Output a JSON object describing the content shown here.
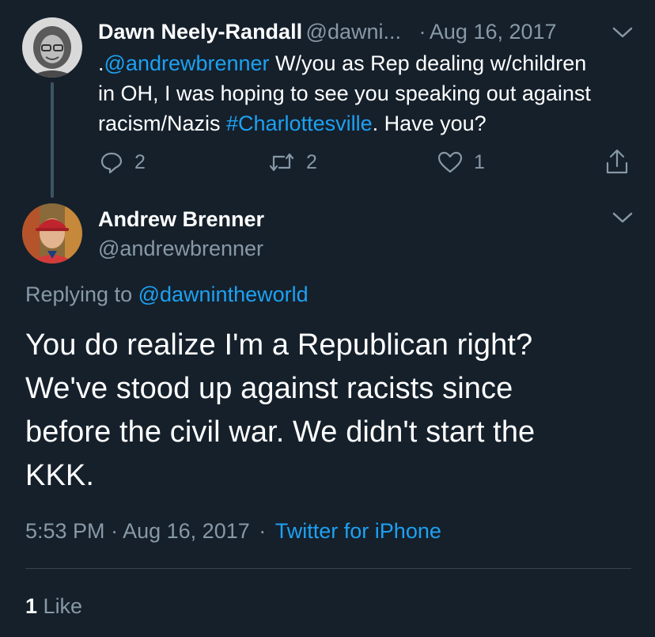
{
  "parent_tweet": {
    "author_name": "Dawn Neely-Randall",
    "author_handle": "@dawni...",
    "date_sep": "·",
    "date": "Aug 16, 2017",
    "text_prefix": ".",
    "mention": "@andrewbrenner",
    "text_line1_rest": " W/you as Rep dealing w/children",
    "text_line2": "in OH, I was hoping to see you speaking out against",
    "text_line3_a": "racism/Nazis ",
    "hashtag": "#Charlottesville",
    "text_line3_b": ". Have you?",
    "replies": "2",
    "retweets": "2",
    "likes": "1"
  },
  "main_tweet": {
    "author_name": "Andrew Brenner",
    "author_handle": "@andrewbrenner",
    "replying_label": "Replying to ",
    "replying_to": "@dawnintheworld",
    "text_lines": [
      "You do realize I'm a Republican right?",
      "We've stood up against racists since",
      "before the civil war. We didn't start the",
      "KKK."
    ],
    "time": "5:53 PM",
    "sep1": "·",
    "date": "Aug 16, 2017",
    "sep2": "·",
    "source": "Twitter for iPhone",
    "like_count": "1",
    "like_label": "Like"
  },
  "icons": [
    "reply-icon",
    "retweet-icon",
    "heart-icon",
    "share-icon",
    "chevron-down-icon"
  ],
  "colors": {
    "background": "#15202b",
    "text": "#ffffff",
    "muted": "#8899a6",
    "link": "#1da1f2",
    "divider": "#38444d"
  }
}
